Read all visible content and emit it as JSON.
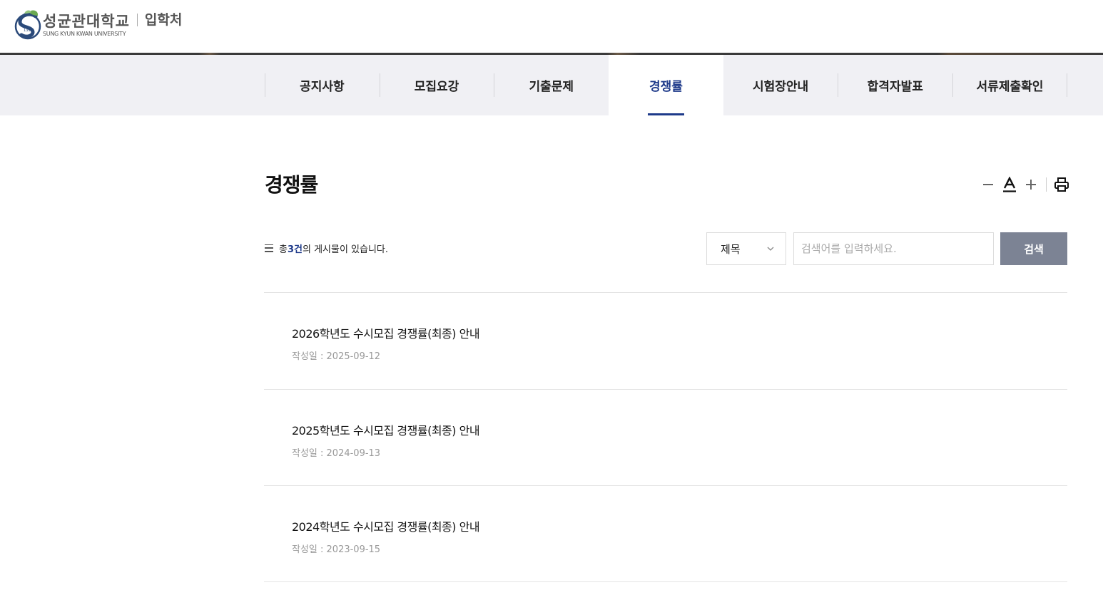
{
  "header": {
    "logo_kr": "성균관대학교",
    "logo_en": "SUNG KYUN KWAN UNIVERSITY",
    "dept": "입학처"
  },
  "nav": {
    "tabs": [
      {
        "label": "공지사항"
      },
      {
        "label": "모집요강"
      },
      {
        "label": "기출문제"
      },
      {
        "label": "경쟁률",
        "active": true
      },
      {
        "label": "시험장안내"
      },
      {
        "label": "합격자발표"
      },
      {
        "label": "서류제출확인"
      }
    ]
  },
  "page": {
    "title": "경쟁률",
    "tools": [
      "minus-icon",
      "font-size-icon",
      "plus-icon",
      "print-icon"
    ]
  },
  "search": {
    "count_prefix": "총 ",
    "count": "3건",
    "count_suffix": "의 게시물이 있습니다.",
    "select_value": "제목",
    "placeholder": "검색어를 입력하세요.",
    "button": "검색"
  },
  "posts": [
    {
      "title": "2026학년도 수시모집 경쟁률(최종) 안내",
      "date": "작성일 : 2025-09-12"
    },
    {
      "title": "2025학년도 수시모집 경쟁률(최종) 안내",
      "date": "작성일 : 2024-09-13"
    },
    {
      "title": "2024학년도 수시모집 경쟁률(최종) 안내",
      "date": "작성일 : 2023-09-15"
    }
  ],
  "colors": {
    "accent": "#1e3a8a",
    "nav_bg": "#f0f0f4",
    "search_button": "#7c8394"
  }
}
